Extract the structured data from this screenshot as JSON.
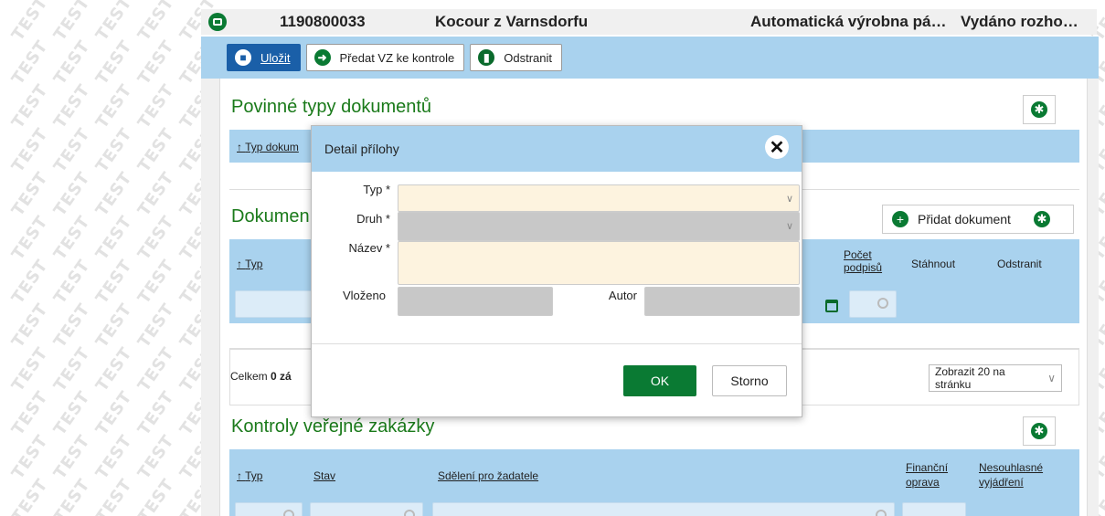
{
  "watermark": {
    "text": "TEST"
  },
  "topbar": {
    "number": "1190800033",
    "name": "Kocour z Varnsdorfu",
    "mode": "Automatická výrobna pá…",
    "status": "Vydáno rozho…"
  },
  "toolbar": {
    "save_label": "Uložit",
    "submit_label": "Předat VZ ke kontrole",
    "delete_label": "Odstranit"
  },
  "sections": {
    "required_docs": {
      "title": "Povinné typy dokumentů",
      "col_type": "Typ dokum"
    },
    "documents": {
      "title": "Dokumen",
      "add_label": "Přidat dokument",
      "col_type": "Typ",
      "col_signatures": "Počet podpisů",
      "col_download": "Stáhnout",
      "col_remove": "Odstranit",
      "total_prefix": "Celkem ",
      "total_value": "0 zá",
      "pager": "Zobrazit 20 na stránku"
    },
    "controls": {
      "title": "Kontroly veřejné zakázky",
      "col_type": "Typ",
      "col_state": "Stav",
      "col_message": "Sdělení pro žadatele",
      "col_fin": "Finanční oprava",
      "col_disagree": "Nesouhlasné vyjádření"
    }
  },
  "modal": {
    "title": "Detail přílohy",
    "type_label": "Typ *",
    "kind_label": "Druh *",
    "name_label": "Název *",
    "inserted_label": "Vloženo",
    "author_label": "Autor",
    "ok_label": "OK",
    "cancel_label": "Storno"
  },
  "colors": {
    "accent_blue": "#a9d2ee",
    "green": "#0a7a33",
    "primary": "#1a5fa8"
  }
}
